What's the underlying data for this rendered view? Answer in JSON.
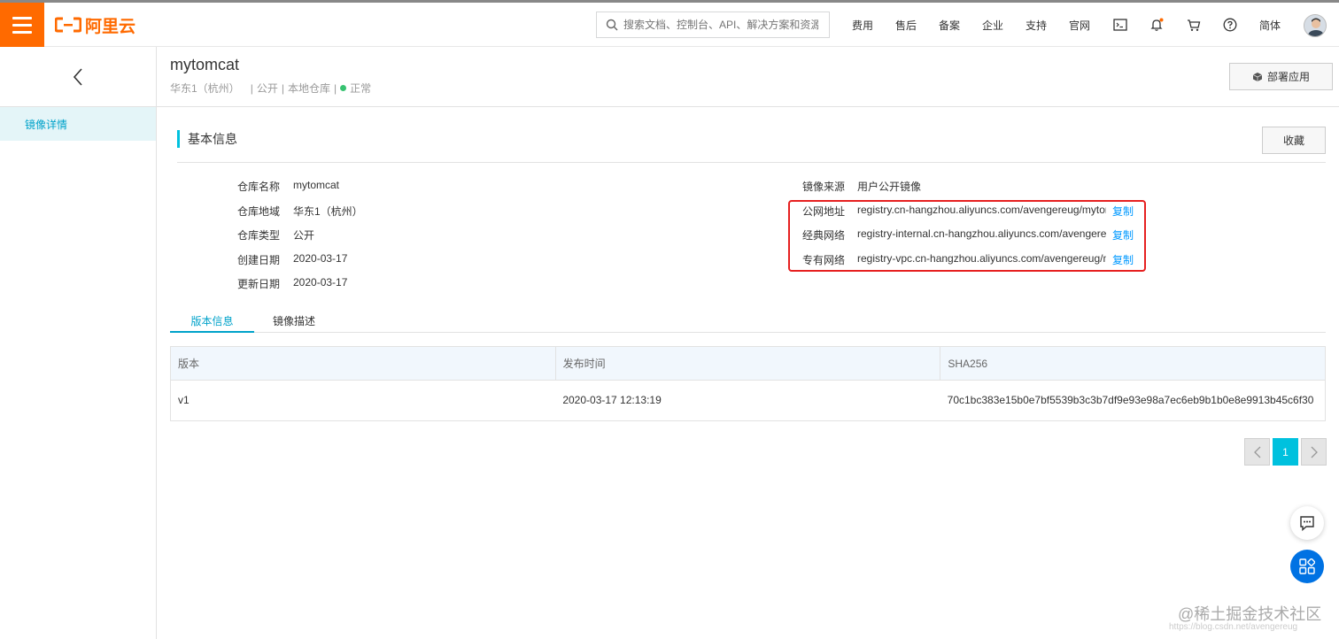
{
  "header": {
    "logo_text": "阿里云",
    "search_placeholder": "搜索文档、控制台、API、解决方案和资源",
    "nav": [
      "费用",
      "售后",
      "备案",
      "企业",
      "支持",
      "官网"
    ],
    "lang": "简体",
    "brand_color": "#ff6a00"
  },
  "sidebar": {
    "items": [
      {
        "label": "镜像详情"
      }
    ]
  },
  "page": {
    "title": "mytomcat",
    "region": "华东1（杭州）",
    "sep1": "|",
    "visibility": "公开",
    "sep2": "|",
    "repo_type": "本地仓库",
    "sep3": "|",
    "status": "正常",
    "deploy_label": "部署应用"
  },
  "basic_info": {
    "title": "基本信息",
    "favorite_label": "收藏",
    "left": [
      {
        "label": "仓库名称",
        "value": "mytomcat"
      },
      {
        "label": "仓库地域",
        "value": "华东1（杭州）"
      },
      {
        "label": "仓库类型",
        "value": "公开"
      },
      {
        "label": "创建日期",
        "value": "2020-03-17"
      },
      {
        "label": "更新日期",
        "value": "2020-03-17"
      }
    ],
    "right": [
      {
        "label": "镜像来源",
        "value": "用户公开镜像"
      },
      {
        "label": "公网地址",
        "value": "registry.cn-hangzhou.aliyuncs.com/avengereug/mytomcat",
        "copy": "复制"
      },
      {
        "label": "经典网络",
        "value": "registry-internal.cn-hangzhou.aliyuncs.com/avengereug/mytomcat",
        "copy": "复制"
      },
      {
        "label": "专有网络",
        "value": "registry-vpc.cn-hangzhou.aliyuncs.com/avengereug/mytomcat",
        "copy": "复制"
      }
    ]
  },
  "tabs": [
    {
      "label": "版本信息",
      "active": true
    },
    {
      "label": "镜像描述",
      "active": false
    }
  ],
  "table": {
    "headers": [
      "版本",
      "发布时间",
      "SHA256"
    ],
    "rows": [
      [
        "v1",
        "2020-03-17 12:13:19",
        "70c1bc383e15b0e7bf5539b3c3b7df9e93e98a7ec6eb9b1b0e8e9913b45c6f30"
      ]
    ]
  },
  "pager": {
    "current": "1"
  },
  "watermark": {
    "main": "@稀土掘金技术社区",
    "sub": "https://blog.csdn.net/avengereug"
  },
  "colors": {
    "accent": "#00c1de",
    "link": "#0099ff",
    "highlight": "#e62020",
    "status_ok": "#37c271"
  }
}
